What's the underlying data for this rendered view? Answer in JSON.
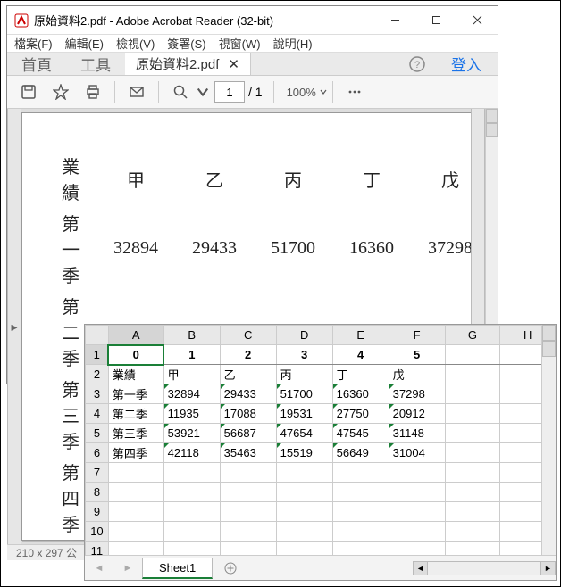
{
  "acrobat": {
    "title": "原始資料2.pdf - Adobe Acrobat Reader (32-bit)",
    "menus": [
      "檔案(F)",
      "編輯(E)",
      "檢視(V)",
      "簽署(S)",
      "視窗(W)",
      "說明(H)"
    ],
    "tabs": {
      "home": "首頁",
      "tools": "工具",
      "doc": "原始資料2.pdf"
    },
    "login": "登入",
    "page_current": "1",
    "page_total": "/ 1",
    "zoom": "100%",
    "status": "210 x 297 公"
  },
  "chart_data": {
    "type": "table",
    "title": "業績",
    "columns": [
      "甲",
      "乙",
      "丙",
      "丁",
      "戊"
    ],
    "rows": [
      "第一季",
      "第二季",
      "第三季",
      "第四季"
    ],
    "values": [
      [
        32894,
        29433,
        51700,
        16360,
        37298
      ],
      [
        11935,
        17088,
        19531,
        27750,
        20912
      ],
      [
        53921,
        56687,
        47654,
        47545,
        31148
      ],
      [
        42118,
        35463,
        15519,
        56649,
        31004
      ]
    ]
  },
  "excel": {
    "columns": [
      "A",
      "B",
      "C",
      "D",
      "E",
      "F",
      "G",
      "H"
    ],
    "max_rows": 12,
    "header_row": [
      "0",
      "1",
      "2",
      "3",
      "4",
      "5"
    ],
    "data": [
      [
        "業績",
        "甲",
        "乙",
        "丙",
        "丁",
        "戊"
      ],
      [
        "第一季",
        "32894",
        "29433",
        "51700",
        "16360",
        "37298"
      ],
      [
        "第二季",
        "11935",
        "17088",
        "19531",
        "27750",
        "20912"
      ],
      [
        "第三季",
        "53921",
        "56687",
        "47654",
        "47545",
        "31148"
      ],
      [
        "第四季",
        "42118",
        "35463",
        "15519",
        "56649",
        "31004"
      ]
    ],
    "sheet": "Sheet1"
  }
}
